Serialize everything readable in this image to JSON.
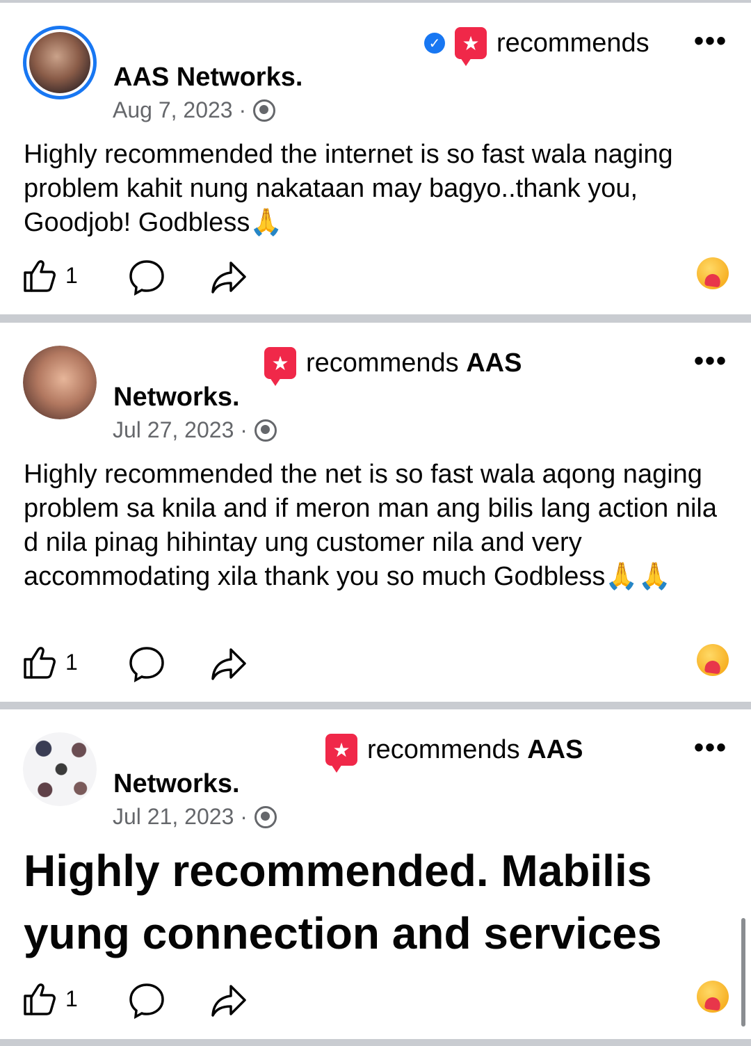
{
  "posts": [
    {
      "rec_prefix": "recommends",
      "rec_suffix": "",
      "name": "AAS Networks.",
      "date": "Aug 7, 2023 ·",
      "text": "Highly recommended the internet is so fast wala naging problem kahit nung nakataan may bagyo..thank you, Goodjob! Godbless🙏",
      "likes": "1",
      "verified": true
    },
    {
      "rec_prefix": "recommends",
      "rec_suffix": "AAS",
      "name": "Networks.",
      "date": "Jul 27, 2023 ·",
      "text": "Highly recommended the net is so fast wala aqong naging problem sa knila and if meron man ang bilis lang action nila d nila pinag hihintay ung customer nila and very accommodating xila  thank you so much Godbless🙏🙏",
      "likes": "1",
      "verified": false
    },
    {
      "rec_prefix": "recommends",
      "rec_suffix": "AAS",
      "name": "Networks.",
      "date": "Jul 21, 2023 ·",
      "text": "Highly recommended. Mabilis yung connection and services",
      "likes": "1",
      "verified": false
    }
  ],
  "icons": {
    "verified": "verified-badge-icon",
    "recommend": "recommend-star-icon",
    "more": "more-options-icon",
    "globe": "globe-icon",
    "like": "thumbs-up-icon",
    "comment": "comment-icon",
    "share": "share-icon",
    "reaction": "care-reaction-icon"
  },
  "colors": {
    "accent": "#1877f2",
    "recommend": "#f02849",
    "muted": "#65676b",
    "separator": "#c9ccd1"
  }
}
